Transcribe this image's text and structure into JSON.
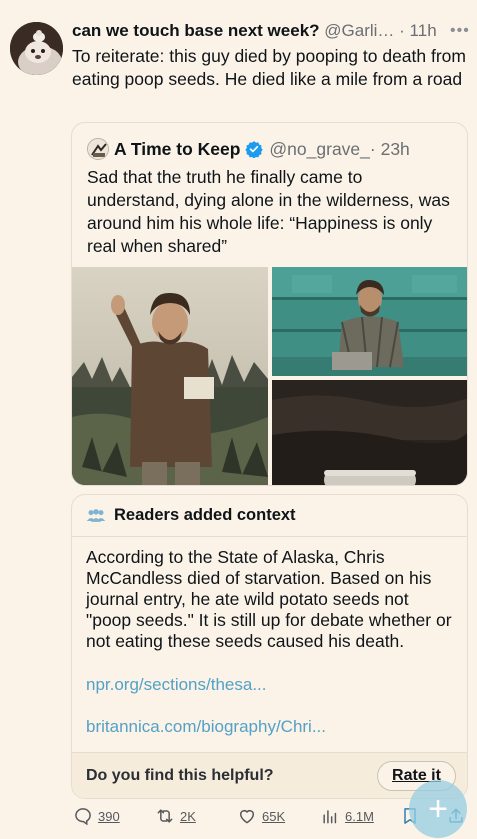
{
  "tweet": {
    "display_name": "can we touch base next week?",
    "handle": "@Garli…",
    "time": "· 11h",
    "more_icon": "ellipsis-icon",
    "text": "To reiterate: this guy died by pooping to death from eating poop seeds. He died like a mile from a road"
  },
  "quote": {
    "display_name": "A Time to Keep",
    "verified_icon": "verified-badge-icon",
    "handle": "@no_grave_",
    "time": "· 23h",
    "text": "Sad that the truth he finally came to understand, dying alone in the wilderness, was around him his whole life: “Happiness is only real when shared”"
  },
  "community_note": {
    "title": "Readers added context",
    "text": "According to the State of Alaska, Chris McCandless died of starvation. Based on his journal entry, he ate wild potato seeds not \"poop seeds.\" It is still up for debate whether or not eating these seeds caused his death.",
    "links": [
      "npr.org/sections/thesa...",
      "britannica.com/biography/Chri..."
    ],
    "helpful_question": "Do you find this helpful?",
    "rate_label": "Rate it"
  },
  "actions": {
    "replies": "390",
    "reposts": "2K",
    "likes": "65K",
    "views": "6.1M"
  },
  "colors": {
    "background": "#fbf3e7",
    "link": "#53a1c7",
    "verified": "#1d9bf0",
    "fab": "#96cde1"
  }
}
